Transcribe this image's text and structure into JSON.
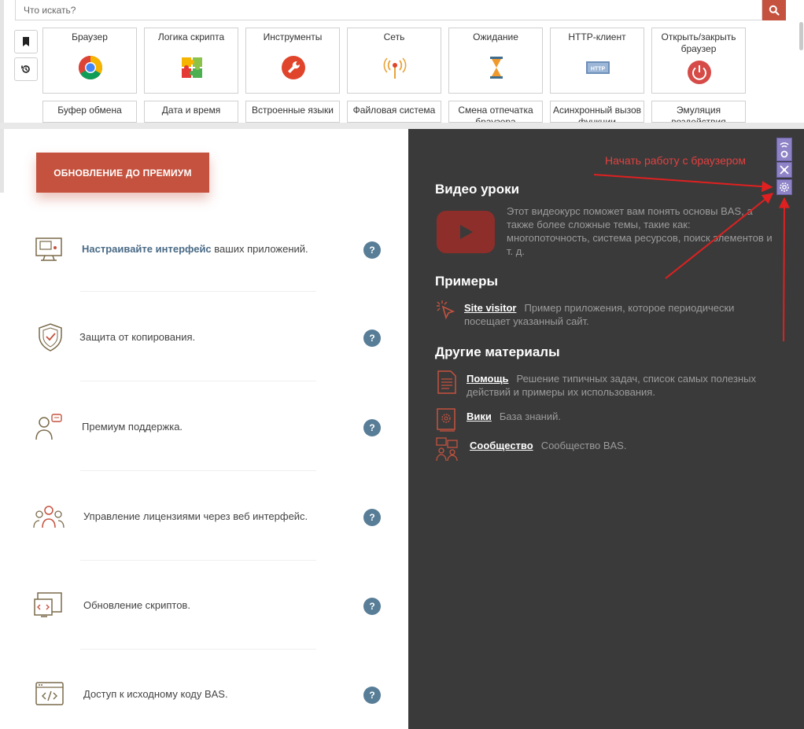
{
  "search": {
    "placeholder": "Что искать?"
  },
  "toolbar": {
    "tiles": [
      {
        "label": "Браузер",
        "icon": "chrome-icon"
      },
      {
        "label": "Логика скрипта",
        "icon": "puzzle-icon"
      },
      {
        "label": "Инструменты",
        "icon": "wrench-icon"
      },
      {
        "label": "Сеть",
        "icon": "antenna-icon"
      },
      {
        "label": "Ожидание",
        "icon": "hourglass-icon"
      },
      {
        "label": "HTTP-клиент",
        "icon": "http-icon"
      },
      {
        "label": "Открыть/закрыть браузер",
        "icon": "power-icon"
      }
    ],
    "row2": [
      "Буфер обмена",
      "Дата и время",
      "Встроенные языки",
      "Файловая система",
      "Смена отпечатка браузера",
      "Асинхронный вызов функции",
      "Эмуляция воздействия"
    ]
  },
  "left": {
    "premium_label": "ОБНОВЛЕНИЕ ДО ПРЕМИУМ",
    "features": [
      {
        "bold": "Настраивайте интерфейс",
        "text": " ваших приложений.",
        "icon": "interface-icon"
      },
      {
        "bold": "",
        "text": "Защита от копирования.",
        "icon": "shield-icon"
      },
      {
        "bold": "",
        "text": "Премиум поддержка.",
        "icon": "support-icon"
      },
      {
        "bold": "",
        "text": "Управление лицензиями через веб интерфейс.",
        "icon": "team-icon"
      },
      {
        "bold": "",
        "text": "Обновление скриптов.",
        "icon": "code-window-icon"
      },
      {
        "bold": "",
        "text": "Доступ к исходному коду BAS.",
        "icon": "source-code-icon"
      }
    ],
    "help_glyph": "?"
  },
  "right": {
    "annotation": "Начать работу с браузером",
    "video": {
      "title": "Видео уроки",
      "text": "Этот видеокурс поможет вам понять основы BAS, а также более сложные темы, такие как: многопоточность, система ресурсов, поиск элементов и т. д."
    },
    "examples": {
      "title": "Примеры",
      "link": "Site visitor",
      "text": "Пример приложения, которое периодически посещает указанный сайт."
    },
    "other": {
      "title": "Другие материалы",
      "items": [
        {
          "link": "Помощь",
          "text": "Решение типичных задач, список самых полезных действий и примеры их использования."
        },
        {
          "link": "Вики",
          "text": "База знаний."
        },
        {
          "link": "Сообщество",
          "text": "Сообщество BAS."
        }
      ]
    }
  },
  "colors": {
    "accent": "#c5523e",
    "dark_panel": "#3a3a3a",
    "help": "#587d97",
    "annotation": "#e34040"
  }
}
